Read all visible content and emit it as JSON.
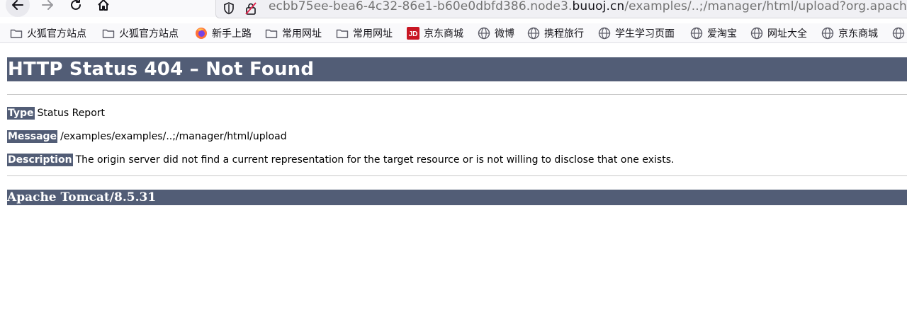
{
  "browser": {
    "url_prefix": "ecbb75ee-bea6-4c32-86e1-b60e0dbfd386.node3.",
    "url_domain": "buuoj.cn",
    "url_path": "/examples/..;/manager/html/upload?org.apache.c",
    "bookmarks": [
      {
        "label": "火狐官方站点",
        "icon": "folder-icon"
      },
      {
        "label": "火狐官方站点",
        "icon": "folder-icon"
      },
      {
        "label": "新手上路",
        "icon": "firefox-icon"
      },
      {
        "label": "常用网址",
        "icon": "folder-icon"
      },
      {
        "label": "常用网址",
        "icon": "folder-icon"
      },
      {
        "label": "京东商城",
        "icon": "jd-icon"
      },
      {
        "label": "微博",
        "icon": "globe-icon"
      },
      {
        "label": "携程旅行",
        "icon": "globe-icon"
      },
      {
        "label": "学生学习页面",
        "icon": "globe-icon"
      },
      {
        "label": "爱淘宝",
        "icon": "globe-icon"
      },
      {
        "label": "网址大全",
        "icon": "globe-icon"
      },
      {
        "label": "京东商城",
        "icon": "globe-icon"
      }
    ],
    "jd_logo_text": "JD"
  },
  "page": {
    "title": "HTTP Status 404 – Not Found",
    "type_label": "Type",
    "type_value": "Status Report",
    "message_label": "Message",
    "message_value": "/examples/examples/..;/manager/html/upload",
    "description_label": "Description",
    "description_value": "The origin server did not find a current representation for the target resource or is not willing to disclose that one exists.",
    "footer": "Apache Tomcat/8.5.31"
  },
  "colors": {
    "tomcat_bar": "#525d76",
    "jd_red": "#c81623"
  }
}
